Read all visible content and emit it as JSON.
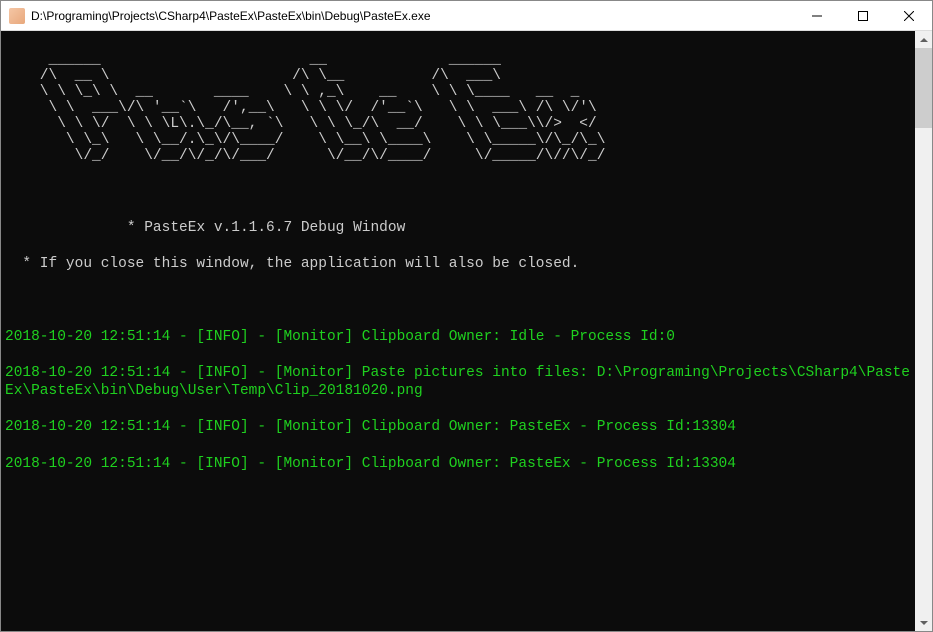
{
  "window": {
    "title": "D:\\Programing\\Projects\\CSharp4\\PasteEx\\PasteEx\\bin\\Debug\\PasteEx.exe"
  },
  "ascii_art": "     ______                        __              ______\n    /\\  __ \\                     /\\ \\__          /\\  ___\\\n    \\ \\ \\_\\ \\  __       ____    \\ \\ ,_\\    __    \\ \\ \\____   __  _\n     \\ \\  ___\\/\\ '__`\\   /',__\\   \\ \\ \\/  /'__`\\   \\ \\  ___\\ /\\ \\/'\\\n      \\ \\ \\/  \\ \\ \\L\\.\\_/\\__, `\\   \\ \\ \\_/\\  __/    \\ \\ \\___\\\\/>  </\n       \\ \\_\\   \\ \\__/.\\_\\/\\____/    \\ \\__\\ \\____\\    \\ \\_____\\/\\_/\\_\\\n        \\/_/    \\/__/\\/_/\\/___/      \\/__/\\/____/     \\/_____/\\//\\/_/",
  "header": {
    "line1": "              * PasteEx v.1.1.6.7 Debug Window",
    "line2": "  * If you close this window, the application will also be closed."
  },
  "logs": [
    "2018-10-20 12:51:14 - [INFO] - [Monitor] Clipboard Owner: Idle - Process Id:0",
    "2018-10-20 12:51:14 - [INFO] - [Monitor] Paste pictures into files: D:\\Programing\\Projects\\CSharp4\\PasteEx\\PasteEx\\bin\\Debug\\User\\Temp\\Clip_20181020.png",
    "2018-10-20 12:51:14 - [INFO] - [Monitor] Clipboard Owner: PasteEx - Process Id:13304",
    "2018-10-20 12:51:14 - [INFO] - [Monitor] Clipboard Owner: PasteEx - Process Id:13304"
  ]
}
